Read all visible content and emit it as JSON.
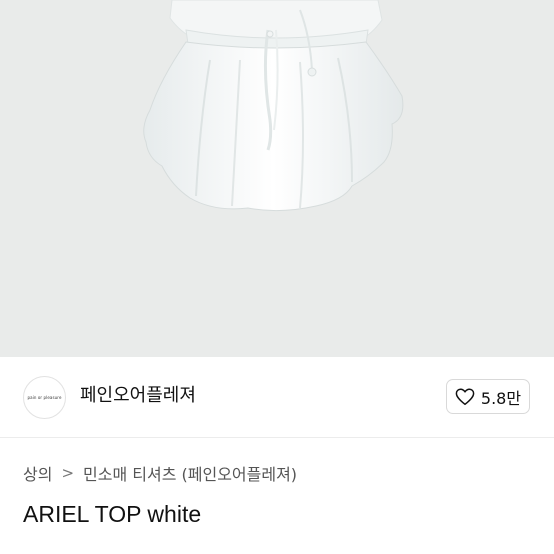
{
  "product_image": {
    "alt": "white ruffle sleeveless top",
    "background_color": "#e9ebea"
  },
  "seller": {
    "logo_text": "pain or pleasure",
    "name": "페인오어플레져"
  },
  "like_button": {
    "icon": "heart-outline-icon",
    "count": "5.8만"
  },
  "breadcrumb": {
    "category": "상의",
    "separator": ">",
    "subcategory": "민소매 티셔츠 (페인오어플레져)"
  },
  "product": {
    "title": "ARIEL TOP white"
  }
}
